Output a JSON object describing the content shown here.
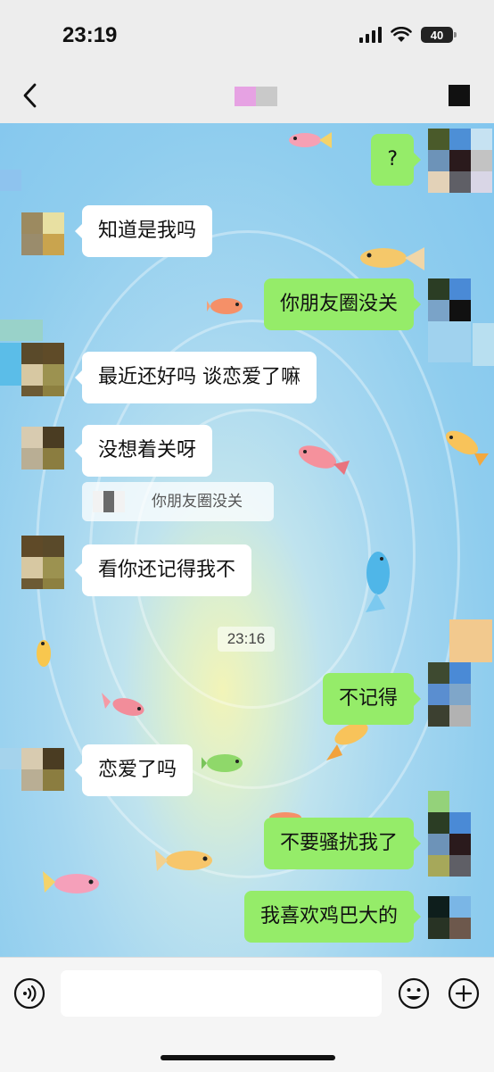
{
  "status": {
    "time": "23:19",
    "battery": "40"
  },
  "messages": [
    {
      "from": "me",
      "text": "?"
    },
    {
      "from": "them",
      "text": "知道是我吗"
    },
    {
      "from": "me",
      "text": "你朋友圈没关"
    },
    {
      "from": "them",
      "text": "最近还好吗 谈恋爱了嘛"
    },
    {
      "from": "them",
      "text": "没想着关呀"
    },
    {
      "from": "them",
      "text": "看你还记得我不"
    },
    {
      "from": "me",
      "text": "不记得"
    },
    {
      "from": "them",
      "text": "恋爱了吗"
    },
    {
      "from": "me",
      "text": "不要骚扰我了"
    },
    {
      "from": "me",
      "text": "我喜欢鸡巴大的"
    }
  ],
  "quote": {
    "text": "你朋友圈没关"
  },
  "time_divider": "23:16",
  "colors": {
    "bubble_out": "#95ec69",
    "bubble_in": "#ffffff",
    "chrome": "#ededed"
  },
  "icons": [
    "back-arrow-icon",
    "more-icon",
    "voice-icon",
    "emoji-icon",
    "plus-icon"
  ]
}
